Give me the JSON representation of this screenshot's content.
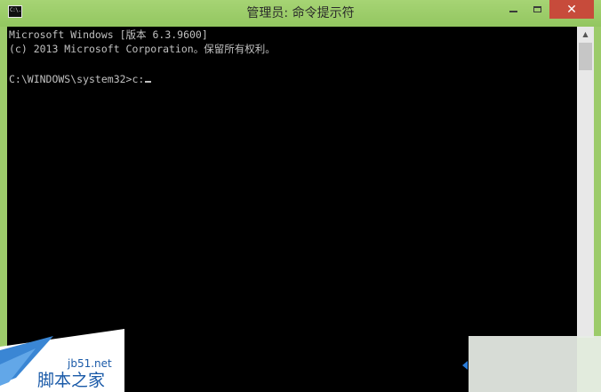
{
  "window": {
    "title": "管理员: 命令提示符",
    "icon_label": "C:\\.",
    "icon": "console-icon",
    "controls": {
      "minimize_icon": "minimize-icon",
      "maximize_icon": "maximize-icon",
      "close_icon": "close-icon",
      "close_glyph": "✕"
    },
    "accent_color": "#9ccb6a",
    "close_color": "#c74b3b"
  },
  "console": {
    "background": "#000000",
    "foreground": "#c0c0c0",
    "lines": [
      "Microsoft Windows [版本 6.3.9600]",
      "(c) 2013 Microsoft Corporation。保留所有权利。",
      "C:\\WINDOWS\\system32>c:"
    ]
  },
  "scrollbar": {
    "up_glyph": "▲"
  },
  "watermark": {
    "url": "jb51.net",
    "name": "脚本之家"
  }
}
